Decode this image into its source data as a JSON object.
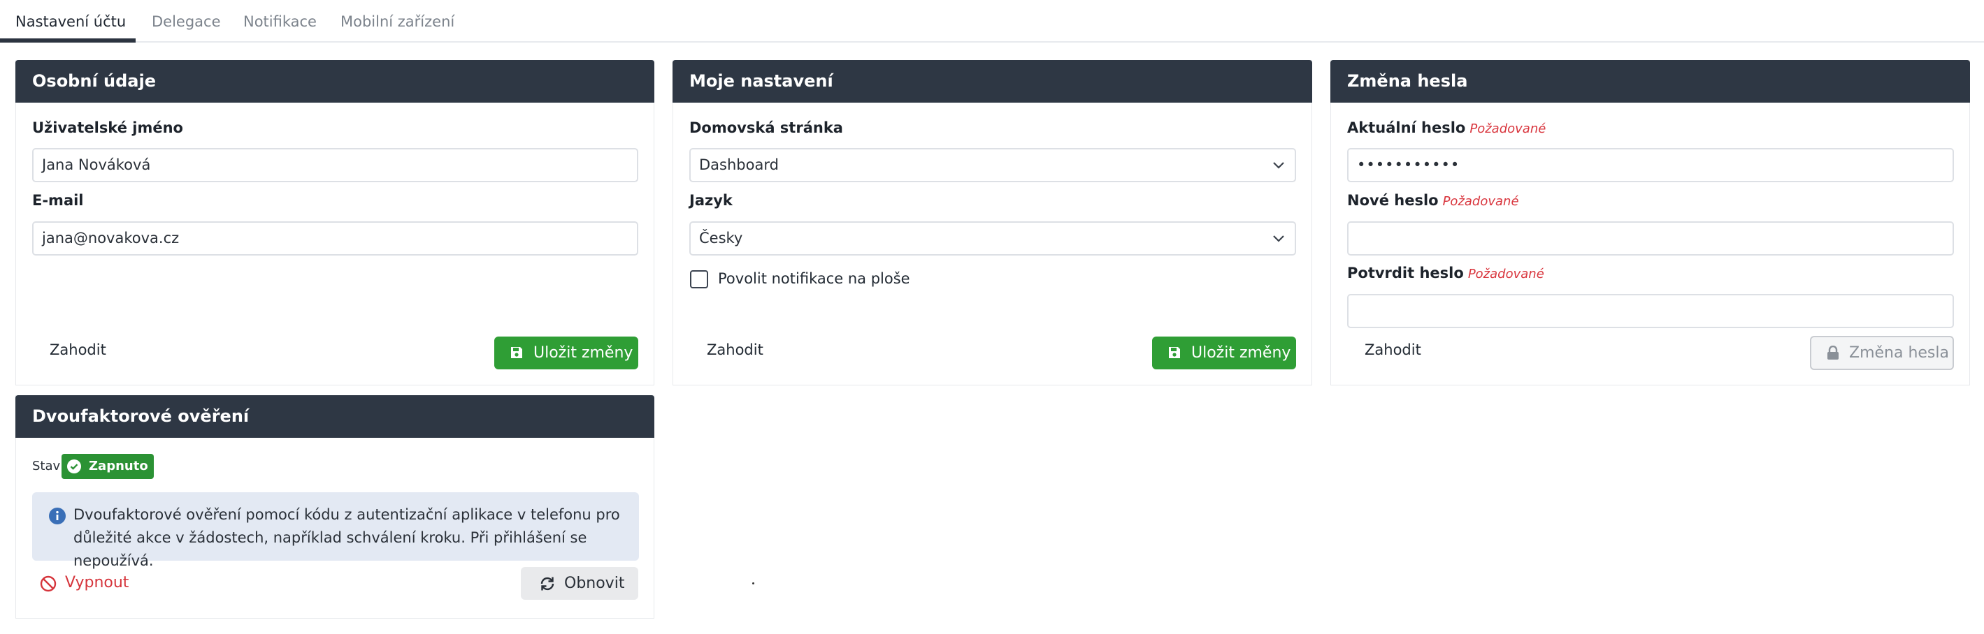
{
  "tabs": [
    {
      "label": "Nastavení účtu",
      "active": true
    },
    {
      "label": "Delegace",
      "active": false
    },
    {
      "label": "Notifikace",
      "active": false
    },
    {
      "label": "Mobilní zařízení",
      "active": false
    }
  ],
  "personal": {
    "title": "Osobní údaje",
    "username_label": "Uživatelské jméno",
    "username_value": "Jana Nováková",
    "email_label": "E-mail",
    "email_value": "jana@novakova.cz",
    "discard_label": "Zahodit",
    "save_label": "Uložit změny"
  },
  "settings": {
    "title": "Moje nastavení",
    "homepage_label": "Domovská stránka",
    "homepage_value": "Dashboard",
    "language_label": "Jazyk",
    "language_value": "Česky",
    "desktop_notifications_label": "Povolit notifikace na ploše",
    "desktop_notifications_checked": false,
    "discard_label": "Zahodit",
    "save_label": "Uložit změny"
  },
  "password": {
    "title": "Změna hesla",
    "current_label": "Aktuální heslo",
    "current_value": "•••••••••••",
    "new_label": "Nové heslo",
    "new_value": "",
    "confirm_label": "Potvrdit heslo",
    "confirm_value": "",
    "required_label": "Požadované",
    "discard_label": "Zahodit",
    "change_label": "Změna hesla"
  },
  "twofa": {
    "title": "Dvoufaktorové ověření",
    "status_label": "Stav",
    "status_value": "Zapnuto",
    "info_text": "Dvoufaktorové ověření pomocí kódu z autentizační aplikace v telefonu pro důležité akce v žádostech, například schválení kroku. Při přihlášení se nepoužívá.",
    "disable_label": "Vypnout",
    "refresh_label": "Obnovit"
  },
  "colors": {
    "header_bg": "#2e3744",
    "success": "#2f9e35",
    "danger": "#d6353c",
    "required": "#d9363e",
    "info_bg": "#e3e9f3"
  },
  "icons": [
    "save-icon",
    "chevron-down-icon",
    "lock-icon",
    "check-circle-icon",
    "info-icon",
    "ban-icon",
    "refresh-icon"
  ]
}
